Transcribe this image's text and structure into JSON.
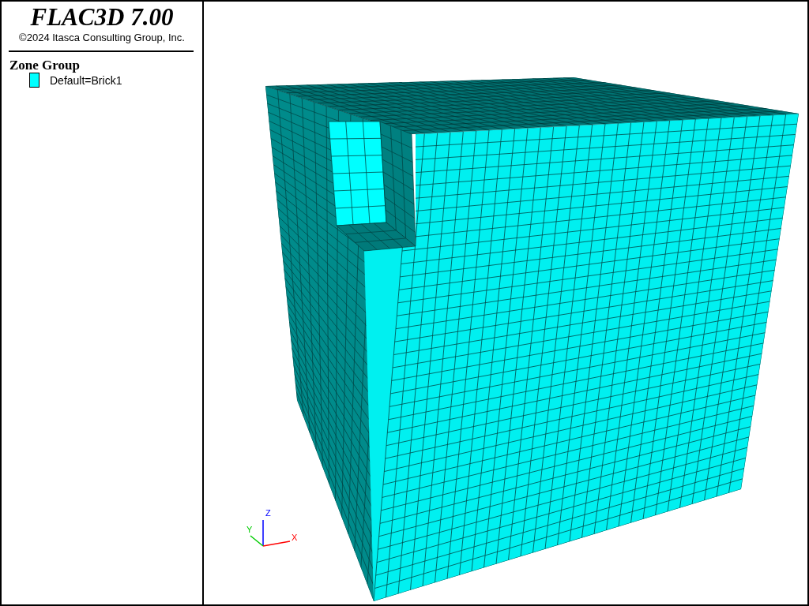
{
  "header": {
    "title": "FLAC3D 7.00",
    "copyright": "©2024 Itasca Consulting Group, Inc."
  },
  "legend": {
    "title": "Zone Group",
    "items": [
      {
        "label": "Default=Brick1",
        "color": "#00ffff"
      }
    ]
  },
  "axes": {
    "labels": [
      {
        "kind": "z",
        "text": "Z"
      },
      {
        "kind": "y",
        "text": "Y"
      },
      {
        "kind": "x",
        "text": "X"
      }
    ]
  }
}
